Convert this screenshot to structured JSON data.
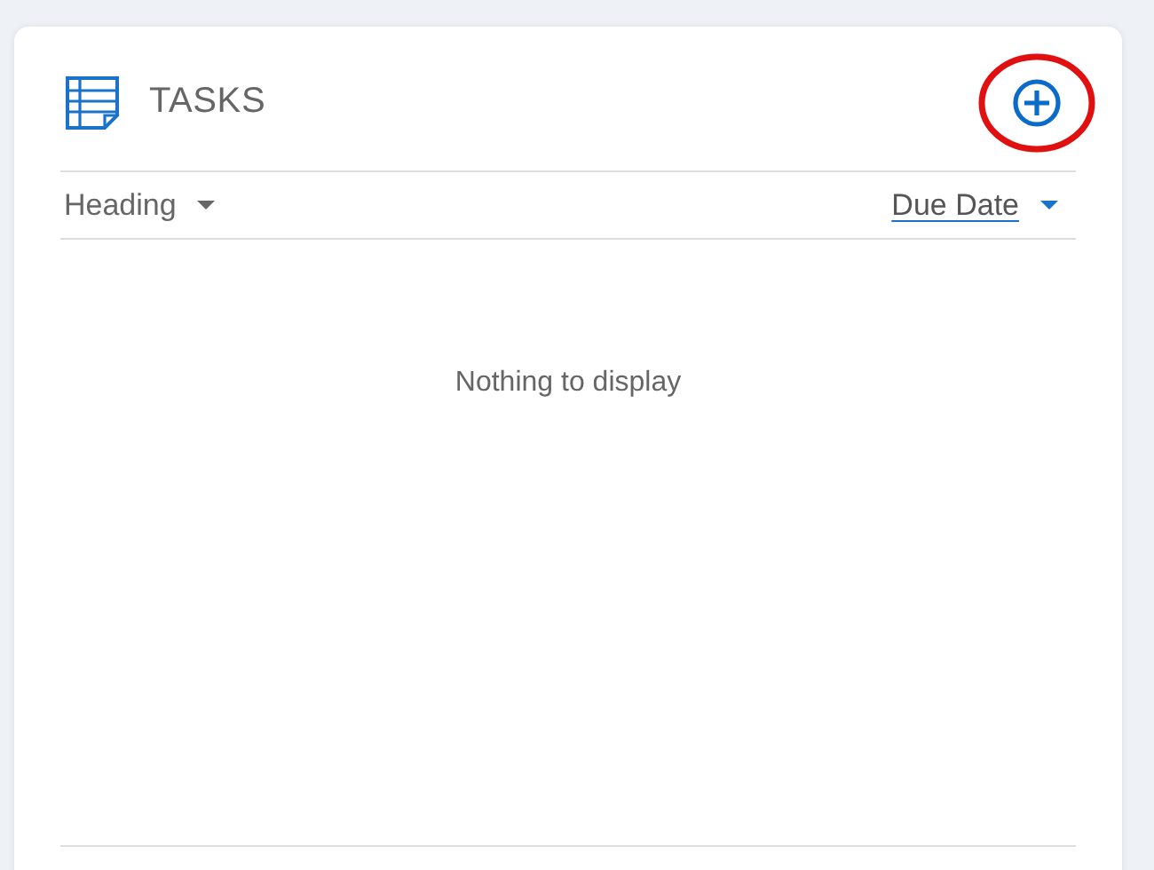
{
  "panel": {
    "title": "TASKS",
    "add_button": {
      "highlighted": true
    }
  },
  "columns": [
    {
      "label": "Heading",
      "selected": false
    },
    {
      "label": "Due Date",
      "selected": true
    }
  ],
  "empty_message": "Nothing to display"
}
